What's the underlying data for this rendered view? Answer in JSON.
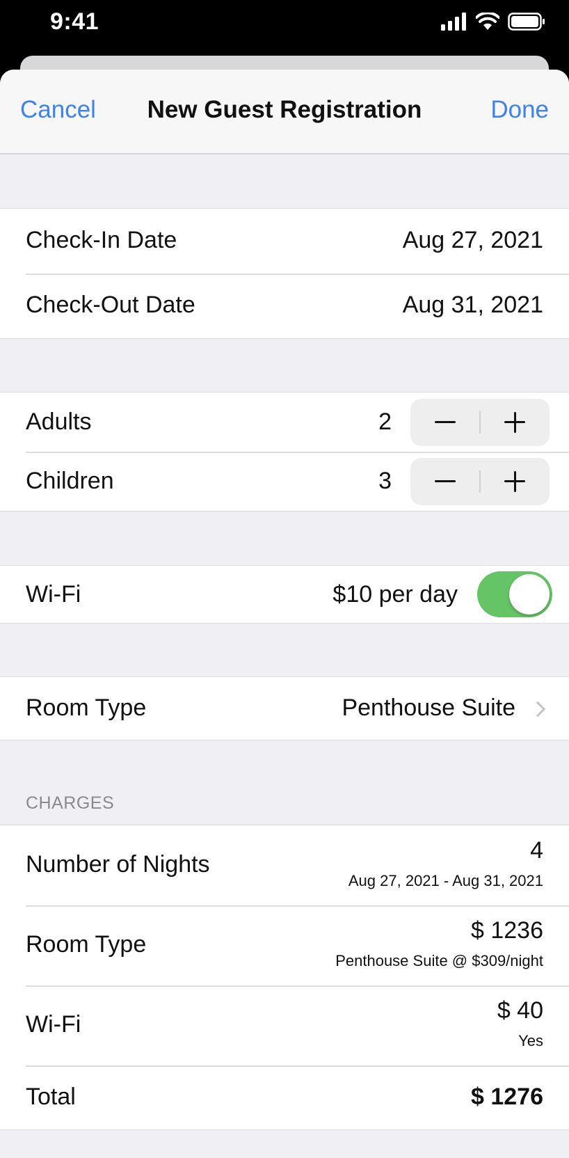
{
  "status": {
    "time": "9:41"
  },
  "nav": {
    "cancel": "Cancel",
    "title": "New Guest Registration",
    "done": "Done"
  },
  "dates": {
    "checkin_label": "Check-In Date",
    "checkin_value": "Aug 27, 2021",
    "checkout_label": "Check-Out Date",
    "checkout_value": "Aug 31, 2021"
  },
  "guests": {
    "adults_label": "Adults",
    "adults_value": "2",
    "children_label": "Children",
    "children_value": "3"
  },
  "wifi": {
    "label": "Wi-Fi",
    "price": "$10 per day",
    "enabled": true
  },
  "room": {
    "label": "Room Type",
    "value": "Penthouse Suite"
  },
  "charges": {
    "header": "CHARGES",
    "nights_label": "Number of Nights",
    "nights_value": "4",
    "nights_detail": "Aug 27, 2021 - Aug 31, 2021",
    "room_label": "Room Type",
    "room_value": "$ 1236",
    "room_detail": "Penthouse Suite @ $309/night",
    "wifi_label": "Wi-Fi",
    "wifi_value": "$ 40",
    "wifi_detail": "Yes",
    "total_label": "Total",
    "total_value": "$ 1276"
  },
  "colors": {
    "accent": "#3e82ed",
    "toggle_on": "#65c466",
    "background": "#efeff4"
  }
}
